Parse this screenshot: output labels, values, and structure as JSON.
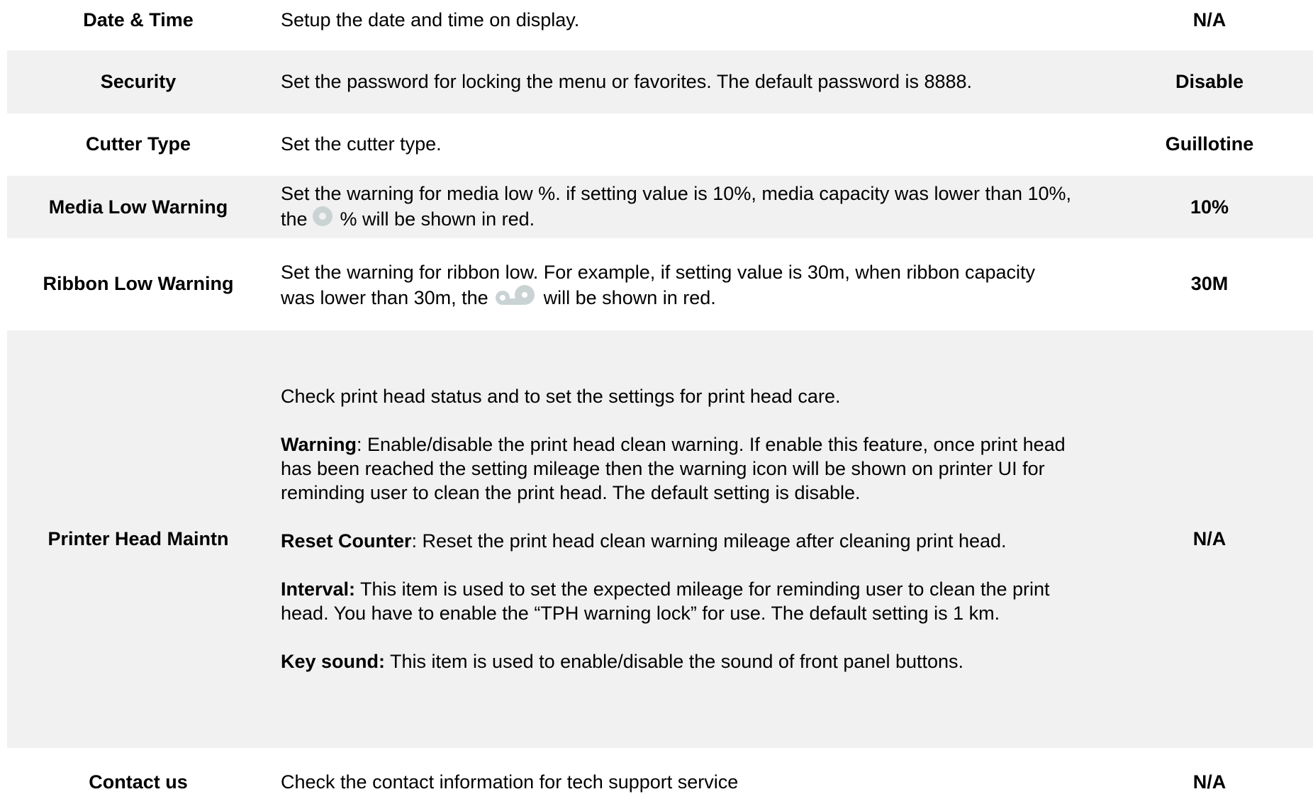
{
  "rows": [
    {
      "name": "Date & Time",
      "description": "Setup the date and time on display.",
      "default": "N/A"
    },
    {
      "name": "Security",
      "description": "Set the password for locking the menu or favorites. The default password is 8888.",
      "default": "Disable"
    },
    {
      "name": "Cutter Type",
      "description": "Set the cutter type.",
      "default": "Guillotine"
    },
    {
      "name": "Media Low Warning",
      "description_before_icon": "Set the warning for media low %. if setting value is 10%, media capacity was lower than 10%, the",
      "icon": "media-roll-icon",
      "description_after_icon": "% will be shown in red.",
      "default": "10%"
    },
    {
      "name": "Ribbon Low Warning",
      "description_before_icon": "Set the warning for ribbon low. For example, if setting value is 30m, when ribbon capacity was lower than 30m, the",
      "icon": "ribbon-rolls-icon",
      "description_after_icon": "will be shown in red.",
      "default": "30M"
    },
    {
      "name": "Printer Head Maintn",
      "intro": "Check print head status and to set the settings for print head care.",
      "items": [
        {
          "label": "Warning",
          "text": ": Enable/disable the print head clean warning. If enable this feature, once print head has been reached the setting mileage then the warning icon will be shown on printer UI for reminding user to clean the print head. The default setting is disable."
        },
        {
          "label": "Reset Counter",
          "text": ": Reset the print head clean warning mileage after cleaning print head."
        },
        {
          "label": "Interval:",
          "text": " This item is used to set the expected mileage for reminding user to clean the print head. You have to enable the “TPH warning lock” for use. The default setting is 1 km."
        },
        {
          "label": "Key sound:",
          "text": " This item is used to enable/disable the sound of front panel buttons."
        }
      ],
      "default": "N/A"
    },
    {
      "name": "Contact us",
      "description": "Check the contact information for tech support service",
      "default": "N/A"
    }
  ],
  "colors": {
    "row_shade": "#f1f1f1",
    "icon_fill": "#c9d3d3"
  }
}
